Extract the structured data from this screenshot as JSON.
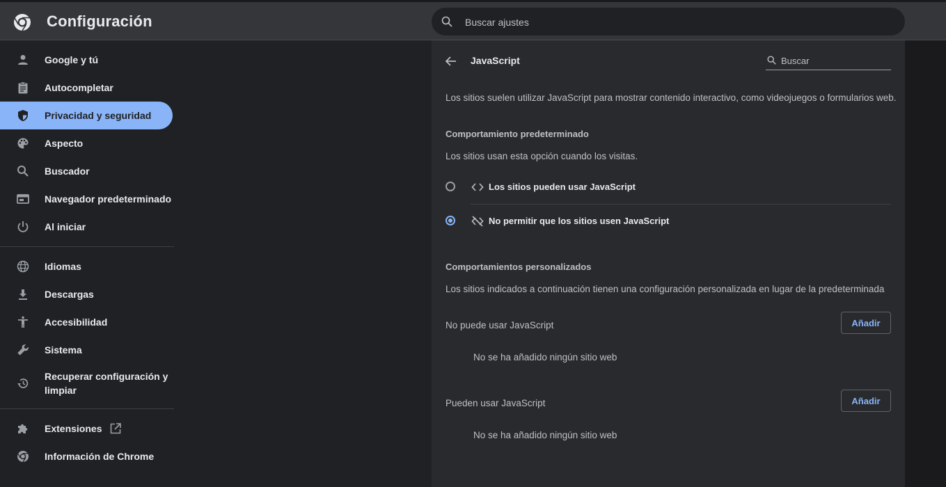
{
  "header": {
    "title": "Configuración",
    "search_placeholder": "Buscar ajustes"
  },
  "sidebar": {
    "items": [
      {
        "label": "Google y tú",
        "icon": "person-icon"
      },
      {
        "label": "Autocompletar",
        "icon": "clipboard-icon"
      },
      {
        "label": "Privacidad y seguridad",
        "icon": "shield-icon",
        "active": true
      },
      {
        "label": "Aspecto",
        "icon": "palette-icon"
      },
      {
        "label": "Buscador",
        "icon": "search-icon"
      },
      {
        "label": "Navegador predeterminado",
        "icon": "browser-window-icon"
      },
      {
        "label": "Al iniciar",
        "icon": "power-icon"
      },
      {
        "label": "Idiomas",
        "icon": "globe-icon"
      },
      {
        "label": "Descargas",
        "icon": "download-icon"
      },
      {
        "label": "Accesibilidad",
        "icon": "accessibility-icon"
      },
      {
        "label": "Sistema",
        "icon": "wrench-icon"
      },
      {
        "label": "Recuperar configuración y limpiar",
        "icon": "restore-icon"
      },
      {
        "label": "Extensiones",
        "icon": "puzzle-icon"
      },
      {
        "label": "Información de Chrome",
        "icon": "chrome-icon"
      }
    ]
  },
  "main": {
    "title": "JavaScript",
    "search_placeholder": "Buscar",
    "description": "Los sitios suelen utilizar JavaScript para mostrar contenido interactivo, como videojuegos o formularios web.",
    "default_section": {
      "heading": "Comportamiento predeterminado",
      "subtext": "Los sitios usan esta opción cuando los visitas.",
      "options": [
        {
          "label": "Los sitios pueden usar JavaScript",
          "icon": "code-icon",
          "checked": false
        },
        {
          "label": "No permitir que los sitios usen JavaScript",
          "icon": "code-off-icon",
          "checked": true
        }
      ]
    },
    "custom_section": {
      "heading": "Comportamientos personalizados",
      "subtext": "Los sitios indicados a continuación tienen una configuración personalizada en lugar de la predeterminada",
      "lists": [
        {
          "label": "No puede usar JavaScript",
          "button": "Añadir",
          "empty": "No se ha añadido ningún sitio web"
        },
        {
          "label": "Pueden usar JavaScript",
          "button": "Añadir",
          "empty": "No se ha añadido ningún sitio web"
        }
      ]
    }
  },
  "colors": {
    "accent": "#8ab4f8",
    "background": "#202124",
    "card": "#292a2d",
    "header": "#35363a"
  }
}
